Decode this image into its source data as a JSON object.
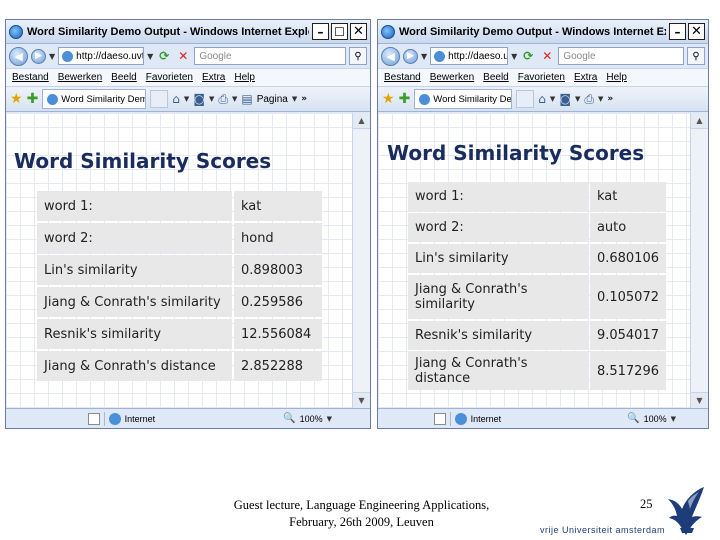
{
  "windows": [
    {
      "title": "Word Similarity Demo Output - Windows Internet Explorer",
      "address": "http://daeso.uvt.nl/",
      "search_placeholder": "Google",
      "menu": [
        "Bestand",
        "Bewerken",
        "Beeld",
        "Favorieten",
        "Extra",
        "Help"
      ],
      "tab_label": "Word Similarity Demo...",
      "page_button": "Pagina",
      "heading": "Word Similarity Scores",
      "rows": [
        {
          "label": "word 1:",
          "value": "kat"
        },
        {
          "label": "word 2:",
          "value": "hond"
        },
        {
          "label": "Lin's similarity",
          "value": "0.898003"
        },
        {
          "label": "Jiang & Conrath's similarity",
          "value": "0.259586"
        },
        {
          "label": "Resnik's similarity",
          "value": "12.556084"
        },
        {
          "label": "Jiang & Conrath's distance",
          "value": "2.852288"
        }
      ],
      "status_zone": "Internet",
      "status_zoom": "100%"
    },
    {
      "title": "Word Similarity Demo Output - Windows Internet Expl...",
      "address": "http://daeso.uv",
      "search_placeholder": "Google",
      "menu": [
        "Bestand",
        "Bewerken",
        "Beeld",
        "Favorieten",
        "Extra",
        "Help"
      ],
      "tab_label": "Word Similarity Dem...",
      "heading": "Word Similarity Scores",
      "rows": [
        {
          "label": "word 1:",
          "value": "kat"
        },
        {
          "label": "word 2:",
          "value": "auto"
        },
        {
          "label": "Lin's similarity",
          "value": "0.680106"
        },
        {
          "label": "Jiang & Conrath's similarity",
          "value": "0.105072"
        },
        {
          "label": "Resnik's similarity",
          "value": "9.054017"
        },
        {
          "label": "Jiang & Conrath's distance",
          "value": "8.517296"
        }
      ],
      "status_zone": "Internet",
      "status_zoom": "100%"
    }
  ],
  "footer": {
    "line1": "Guest lecture, Language Engineering Applications,",
    "line2": "February, 26th 2009, Leuven",
    "slide_number": "25",
    "institution": "vrije Universiteit   amsterdam"
  }
}
